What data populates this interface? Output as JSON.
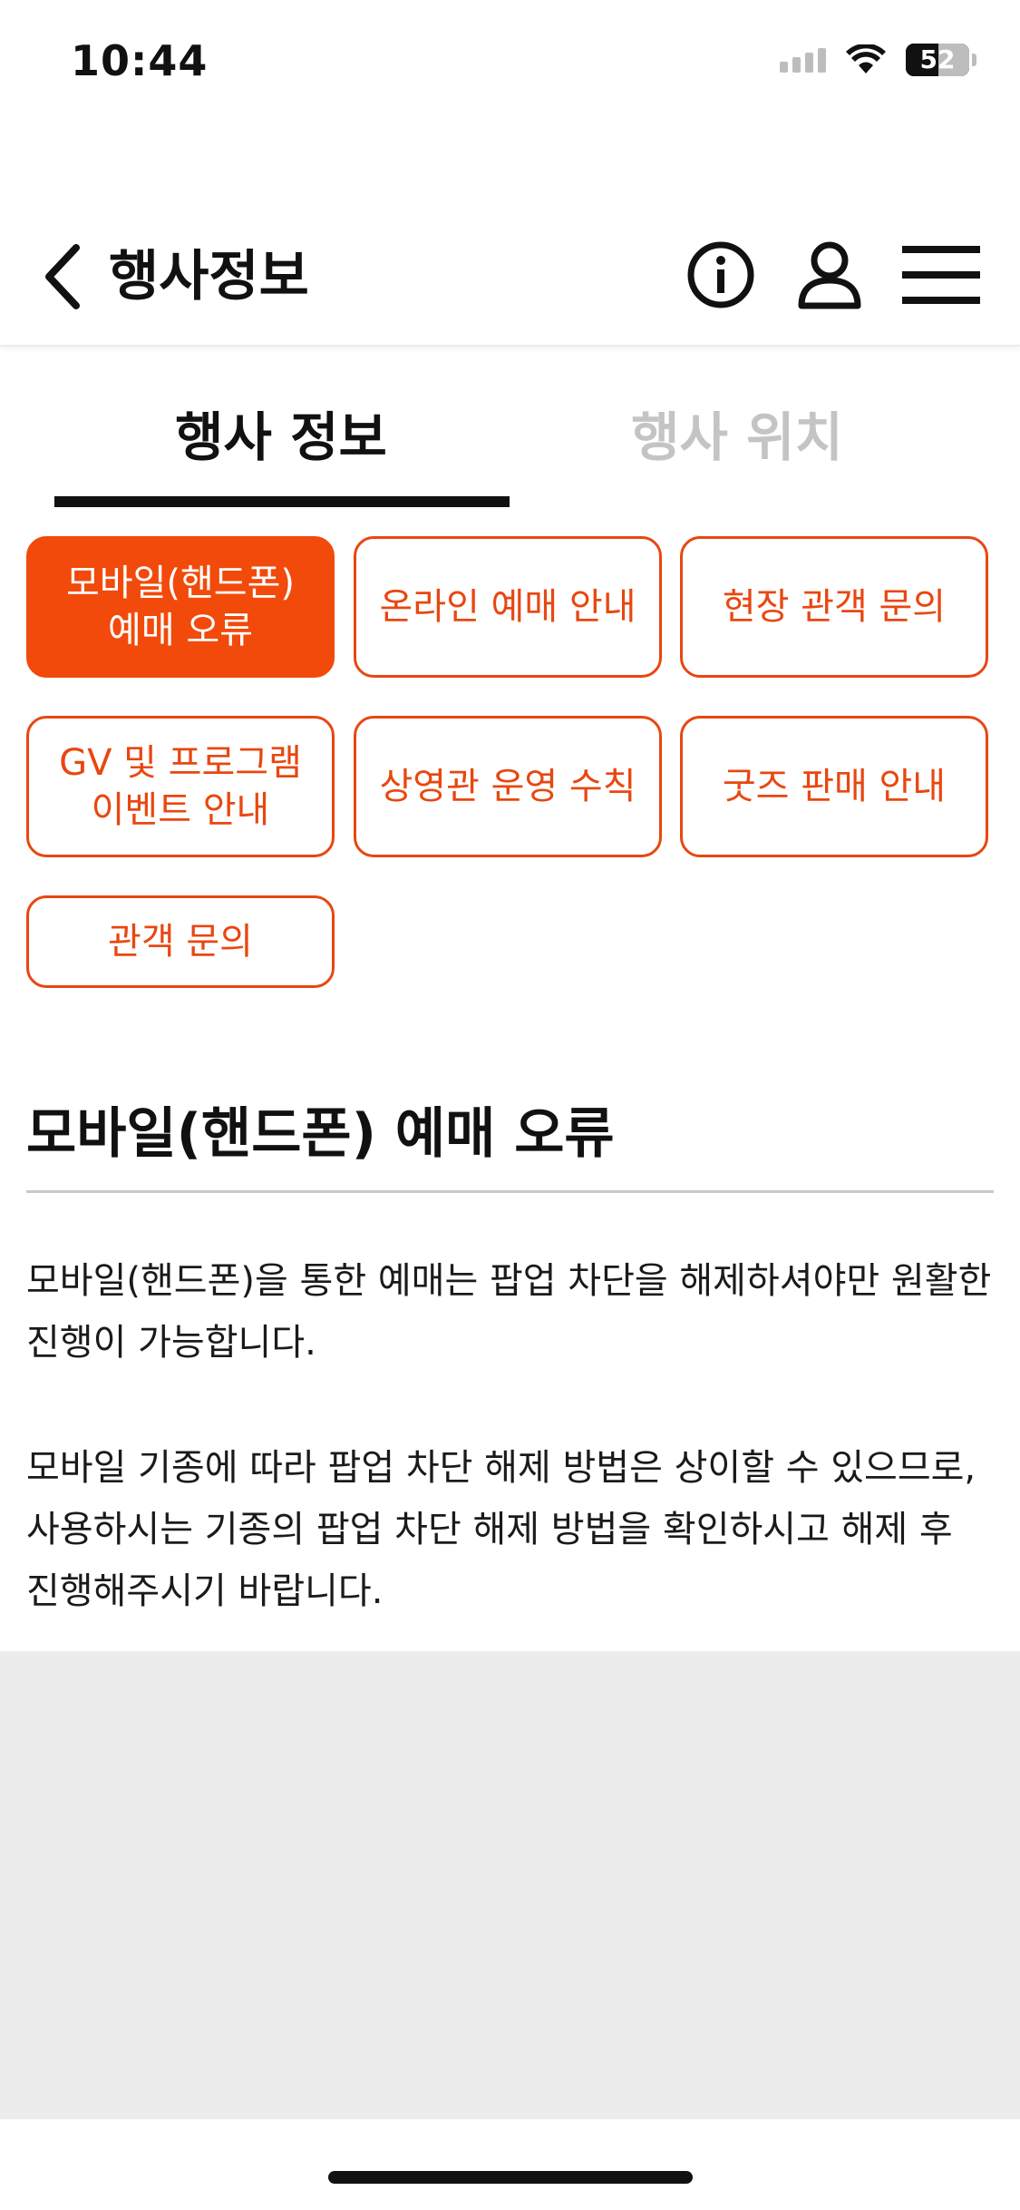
{
  "status_bar": {
    "time": "10:44",
    "battery": "52",
    "battery_level": 0.52
  },
  "header": {
    "title": "행사정보",
    "icons": [
      "back-chevron-icon",
      "info-icon",
      "user-icon",
      "hamburger-menu-icon"
    ]
  },
  "tabs": [
    {
      "label": "행사 정보",
      "active": true
    },
    {
      "label": "행사 위치",
      "active": false
    }
  ],
  "categories": [
    {
      "label": "모바일(핸드폰)\n예매 오류",
      "active": true
    },
    {
      "label": "온라인 예매 안내",
      "active": false
    },
    {
      "label": "현장 관객 문의",
      "active": false
    },
    {
      "label": "GV 및 프로그램\n이벤트 안내",
      "active": false
    },
    {
      "label": "상영관 운영 수칙",
      "active": false
    },
    {
      "label": "굿즈 판매 안내",
      "active": false
    },
    {
      "label": "관객 문의",
      "active": false
    }
  ],
  "content": {
    "title": "모바일(핸드폰) 예매 오류",
    "paragraph1": "모바일(핸드폰)을 통한 예매는 팝업 차단을 해제하셔야만 원활한 진행이 가능합니다.",
    "paragraph2": "모바일 기종에 따라 팝업 차단 해제 방법은 상이할 수 있으므로, 사용하시는 기종의 팝업 차단 해제 방법을 확인하시고 해제 후 진행해주시기 바랍니다."
  },
  "colors": {
    "accent": "#f24a0b",
    "accent_border": "#e84710",
    "inactive_tab": "#c4c4c4",
    "gray_area": "#ececec"
  }
}
